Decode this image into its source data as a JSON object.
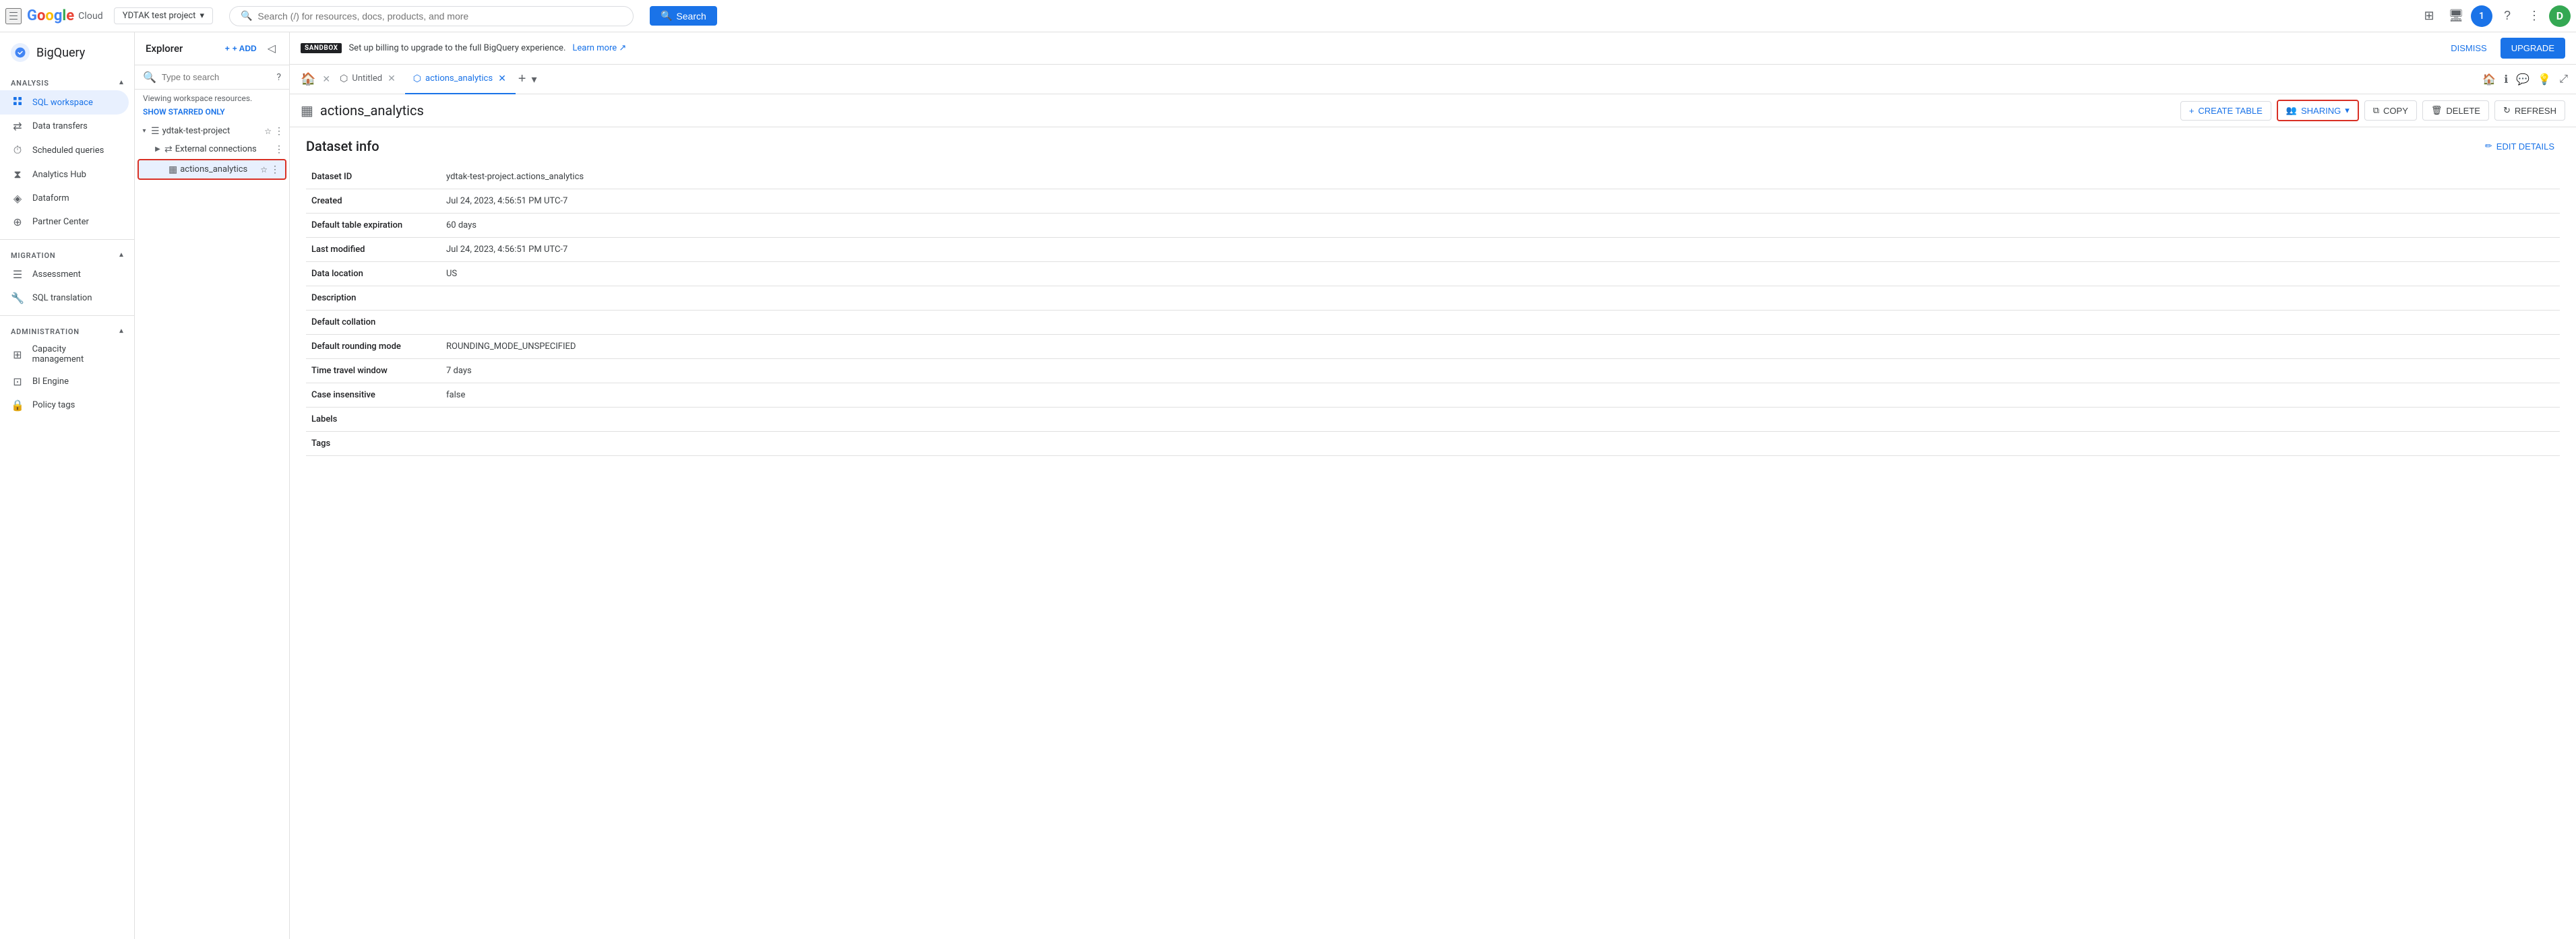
{
  "topnav": {
    "project_name": "YDTAK test project",
    "search_placeholder": "Search (/) for resources, docs, products, and more",
    "search_button_label": "Search",
    "avatar_initial": "1"
  },
  "sidebar_brand": {
    "label": "BigQuery"
  },
  "sidebar": {
    "sections": [
      {
        "id": "analysis",
        "label": "Analysis",
        "items": [
          {
            "id": "sql-workspace",
            "label": "SQL workspace",
            "icon": "⬡",
            "active": true
          },
          {
            "id": "data-transfers",
            "label": "Data transfers",
            "icon": "⇄"
          },
          {
            "id": "scheduled-queries",
            "label": "Scheduled queries",
            "icon": "⏱"
          },
          {
            "id": "analytics-hub",
            "label": "Analytics Hub",
            "icon": "⧗"
          },
          {
            "id": "dataform",
            "label": "Dataform",
            "icon": "◈"
          },
          {
            "id": "partner-center",
            "label": "Partner Center",
            "icon": "⊕"
          }
        ]
      },
      {
        "id": "migration",
        "label": "Migration",
        "items": [
          {
            "id": "assessment",
            "label": "Assessment",
            "icon": "☰"
          },
          {
            "id": "sql-translation",
            "label": "SQL translation",
            "icon": "🔧"
          }
        ]
      },
      {
        "id": "administration",
        "label": "Administration",
        "items": [
          {
            "id": "capacity-management",
            "label": "Capacity management",
            "icon": "⊞"
          },
          {
            "id": "bi-engine",
            "label": "BI Engine",
            "icon": "⊡"
          },
          {
            "id": "policy-tags",
            "label": "Policy tags",
            "icon": "🔒"
          }
        ]
      }
    ]
  },
  "explorer": {
    "title": "Explorer",
    "add_label": "+ ADD",
    "search_placeholder": "Type to search",
    "viewing_text": "Viewing workspace resources.",
    "show_starred_label": "SHOW STARRED ONLY",
    "project_name": "ydtak-test-project",
    "tree_items": [
      {
        "id": "external-connections",
        "label": "External connections",
        "icon": "⇄",
        "indent": 1
      },
      {
        "id": "actions-analytics",
        "label": "actions_analytics",
        "icon": "▦",
        "indent": 1,
        "selected": true,
        "highlighted": true
      }
    ]
  },
  "tabs": [
    {
      "id": "home",
      "icon": "🏠",
      "type": "home"
    },
    {
      "id": "untitled",
      "label": "Untitled",
      "closable": true,
      "active": false
    },
    {
      "id": "actions-analytics",
      "label": "actions_analytics",
      "closable": true,
      "active": true,
      "icon": "⬡"
    }
  ],
  "content": {
    "dataset_name": "actions_analytics",
    "toolbar": {
      "create_table_label": "CREATE TABLE",
      "sharing_label": "SHARING",
      "copy_label": "COPY",
      "delete_label": "DELETE",
      "refresh_label": "REFRESH"
    },
    "edit_details_label": "EDIT DETAILS",
    "dataset_info_title": "Dataset info",
    "fields": [
      {
        "label": "Dataset ID",
        "value": "ydtak-test-project.actions_analytics"
      },
      {
        "label": "Created",
        "value": "Jul 24, 2023, 4:56:51 PM UTC-7"
      },
      {
        "label": "Default table expiration",
        "value": "60 days"
      },
      {
        "label": "Last modified",
        "value": "Jul 24, 2023, 4:56:51 PM UTC-7"
      },
      {
        "label": "Data location",
        "value": "US"
      },
      {
        "label": "Description",
        "value": ""
      },
      {
        "label": "Default collation",
        "value": ""
      },
      {
        "label": "Default rounding mode",
        "value": "ROUNDING_MODE_UNSPECIFIED"
      },
      {
        "label": "Time travel window",
        "value": "7 days"
      },
      {
        "label": "Case insensitive",
        "value": "false"
      },
      {
        "label": "Labels",
        "value": ""
      },
      {
        "label": "Tags",
        "value": ""
      }
    ]
  },
  "sandbox_banner": {
    "badge_label": "SANDBOX",
    "message": "Set up billing to upgrade to the full BigQuery experience.",
    "learn_more_label": "Learn more",
    "dismiss_label": "DISMISS",
    "upgrade_label": "UPGRADE"
  }
}
